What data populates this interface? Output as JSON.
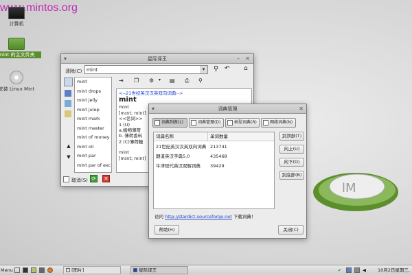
{
  "watermark": "www.mintos.org",
  "desktop": {
    "icons": [
      {
        "label": "计算机"
      },
      {
        "label": "mint 的主文件夹"
      },
      {
        "label": "安装 Linux Mint"
      }
    ]
  },
  "stardict": {
    "title": "星际译王",
    "search_label": "清除(C)",
    "search_value": "mint",
    "words": [
      "mint",
      "mint drops",
      "mint jelly",
      "mint julep",
      "mint mark",
      "mint master",
      "mint of money",
      "mint oil",
      "mint par",
      "mint par of exc"
    ],
    "definition": {
      "header": "<--21世纪英汉汉英双向词典-->",
      "headword": "mint",
      "lines": [
        "mint",
        "[mɪnt; mint]",
        "<<名词>>",
        "1 (U)",
        "a.植物薄荷",
        "b. 薄荷香料",
        "2 (C)薄荷糖"
      ],
      "headword2": "mint",
      "lines2": [
        "[mɪnt; mint]"
      ]
    },
    "cancel_label": "取消(S)"
  },
  "dictmgr": {
    "title": "词典管理",
    "tabs": [
      "词典列表(L)",
      "词典管理(D)",
      "树型词典(R)",
      "网络词典(N)"
    ],
    "columns": [
      "词典名称",
      "单词数量"
    ],
    "rows": [
      {
        "name": "21世纪英汉汉英双向词典",
        "count": "213741"
      },
      {
        "name": "朗道英汉字典5.0",
        "count": "435468"
      },
      {
        "name": "牛津现代英汉双解词典",
        "count": "39429"
      }
    ],
    "side_buttons": [
      "到顶部(T)",
      "向上(U)",
      "向下(D)",
      "到底部(B)"
    ],
    "visit_prefix": "访问 ",
    "link": "http://stardict.sourceforge.net",
    "visit_suffix": " 下载词典！",
    "help": "帮助(H)",
    "close": "关闭(C)"
  },
  "taskbar": {
    "menu": "Menu",
    "tasks": [
      "[图片]",
      "星际译王"
    ],
    "clock": "10月2日星期三,"
  }
}
